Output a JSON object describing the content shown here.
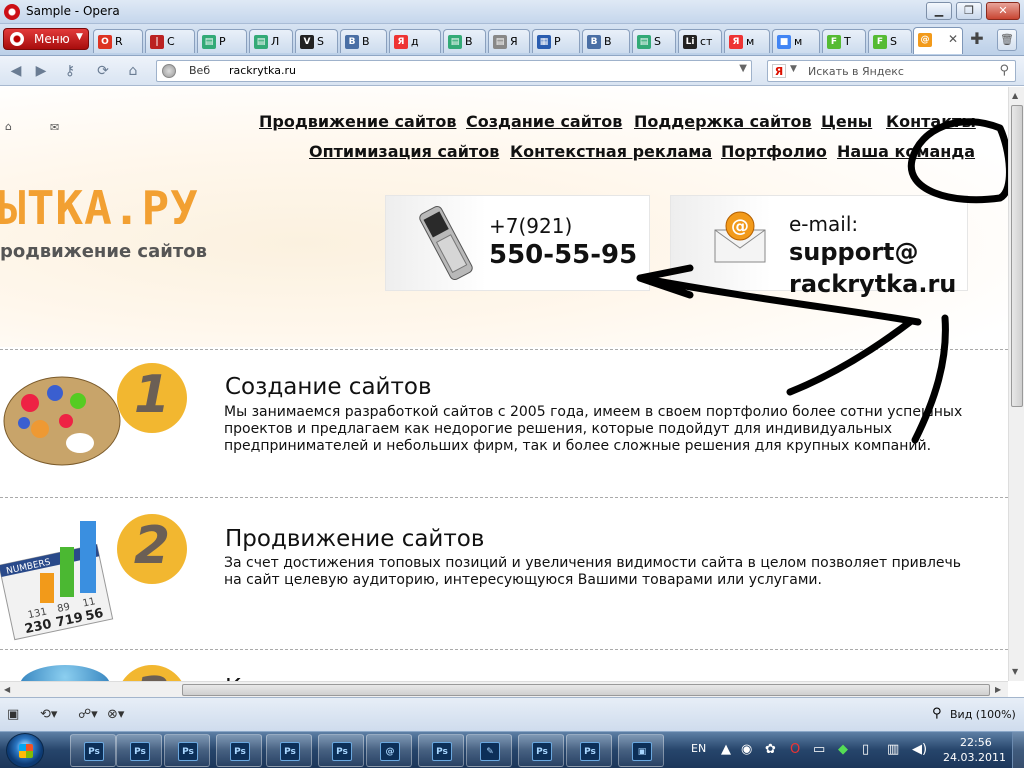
{
  "window": {
    "title": "Sample - Opera"
  },
  "menu": {
    "label": "Меню"
  },
  "tabs": [
    {
      "label": "R",
      "fav": "#d32",
      "ftxt": "O"
    },
    {
      "label": "C",
      "fav": "#b22",
      "ftxt": "|"
    },
    {
      "label": "P",
      "fav": "#3a7",
      "ftxt": "▤"
    },
    {
      "label": "Л",
      "fav": "#3a7",
      "ftxt": "▤"
    },
    {
      "label": "S",
      "fav": "#222",
      "ftxt": "V"
    },
    {
      "label": "В",
      "fav": "#4a6fa5",
      "ftxt": "B"
    },
    {
      "label": "д",
      "fav": "#e33",
      "ftxt": "Я"
    },
    {
      "label": "В",
      "fav": "#3a7",
      "ftxt": "▤"
    },
    {
      "label": "Я",
      "fav": "#888",
      "ftxt": "▤"
    },
    {
      "label": "P",
      "fav": "#2a5db0",
      "ftxt": "▦"
    },
    {
      "label": "В",
      "fav": "#4a6fa5",
      "ftxt": "B"
    },
    {
      "label": "S",
      "fav": "#3a7",
      "ftxt": "▤"
    },
    {
      "label": "ст",
      "fav": "#222",
      "ftxt": "Li"
    },
    {
      "label": "м",
      "fav": "#e33",
      "ftxt": "Я"
    },
    {
      "label": "м",
      "fav": "#4285f4",
      "ftxt": "■"
    },
    {
      "label": "T",
      "fav": "#5b3",
      "ftxt": "F"
    },
    {
      "label": "S",
      "fav": "#5b3",
      "ftxt": "F"
    }
  ],
  "address": {
    "web_label": "Веб",
    "url": "rackrytka.ru",
    "search_placeholder": "Искать в Яндекс"
  },
  "site": {
    "nav_row1": [
      "Продвижение сайтов",
      "Создание сайтов",
      "Поддержка сайтов",
      "Цены",
      "Контакты"
    ],
    "nav_row2": [
      "Оптимизация сайтов",
      "Контекстная реклама",
      "Портфолио",
      "Наша команда"
    ],
    "logo": "ЫТКА.РУ",
    "slogan": "родвижение сайтов",
    "phone": {
      "prefix": "+7(921)",
      "number": "550-55-95"
    },
    "email": {
      "label": "e-mail:",
      "line1": "support@",
      "line2": "rackrytka.ru"
    },
    "services": [
      {
        "number": "1",
        "title": "Создание сайтов",
        "text": "Мы занимаемся разработкой сайтов с 2005 года, имеем в своем портфолио более сотни успешных проектов и предлагаем как недорогие решения, которые подойдут для индивидуальных предпринимателей и небольших фирм, так и более сложные решения для крупных компаний."
      },
      {
        "number": "2",
        "title": "Продвижение сайтов",
        "text": "За счет достижения топовых позиций и увеличения видимости сайта в целом позволяет привлечь на сайт целевую аудиторию, интересующуюся Вашими товарами или услугами."
      },
      {
        "number": "3",
        "title": "К"
      }
    ],
    "chart_numbers": {
      "header": "NUMBERS",
      "rows": [
        [
          "131",
          "89",
          "11"
        ],
        [
          "230",
          "719",
          "56"
        ]
      ]
    }
  },
  "status": {
    "zoom": "Вид (100%)"
  },
  "taskbar": {
    "apps": [
      "Ps",
      "Ps",
      "Ps",
      "Ps",
      "Ps",
      "Ps",
      "@",
      "Ps",
      "✎",
      "Ps",
      "Ps",
      "▣"
    ],
    "lang": "EN",
    "time": "22:56",
    "date": "24.03.2011"
  },
  "colors": {
    "accent_orange": "#f2a032",
    "badge_yellow": "#f2b730",
    "opera_red": "#cc0f16"
  }
}
